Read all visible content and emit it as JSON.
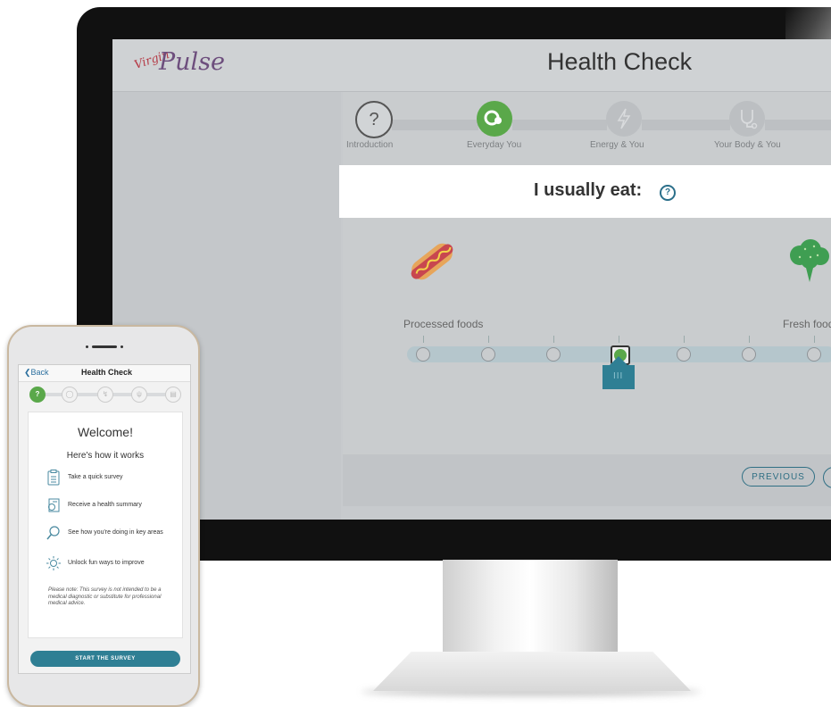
{
  "desktop": {
    "brand": {
      "mark": "Virgin",
      "word": "Pulse"
    },
    "title": "Health Check",
    "steps": [
      {
        "label": "Introduction",
        "icon": "question-icon",
        "state": "complete"
      },
      {
        "label": "Everyday You",
        "icon": "everyday-icon",
        "state": "active"
      },
      {
        "label": "Energy & You",
        "icon": "energy-icon",
        "state": "upcoming"
      },
      {
        "label": "Your Body & You",
        "icon": "stethoscope-icon",
        "state": "upcoming"
      }
    ],
    "question": {
      "text": "I usually eat:",
      "help": "?"
    },
    "scale": {
      "left_label": "Processed foods",
      "right_label": "Fresh food",
      "left_icon": "hotdog-icon",
      "right_icon": "broccoli-icon",
      "options": 7,
      "selected_index": 3,
      "handle_grip": "III"
    },
    "buttons": {
      "previous": "PREVIOUS"
    }
  },
  "phone": {
    "back_label": "Back",
    "title": "Health Check",
    "intro_step": "?",
    "welcome": "Welcome!",
    "how_it_works": "Here's how it works",
    "features": [
      {
        "text": "Take a quick survey",
        "icon": "clipboard-icon"
      },
      {
        "text": "Receive a health summary",
        "icon": "health-summary-icon"
      },
      {
        "text": "See how you're doing in key areas",
        "icon": "magnifier-icon"
      },
      {
        "text": "Unlock fun ways to improve",
        "icon": "sun-icon"
      }
    ],
    "note": "Please note: This survey is not intended to be a medical diagnostic or substitute for professional medical advice.",
    "start_button": "START THE SURVEY"
  },
  "colors": {
    "accent_green": "#5aa84a",
    "teal": "#2f7f94",
    "brand_red": "#b53a46",
    "brand_purple": "#6d4e7d"
  }
}
